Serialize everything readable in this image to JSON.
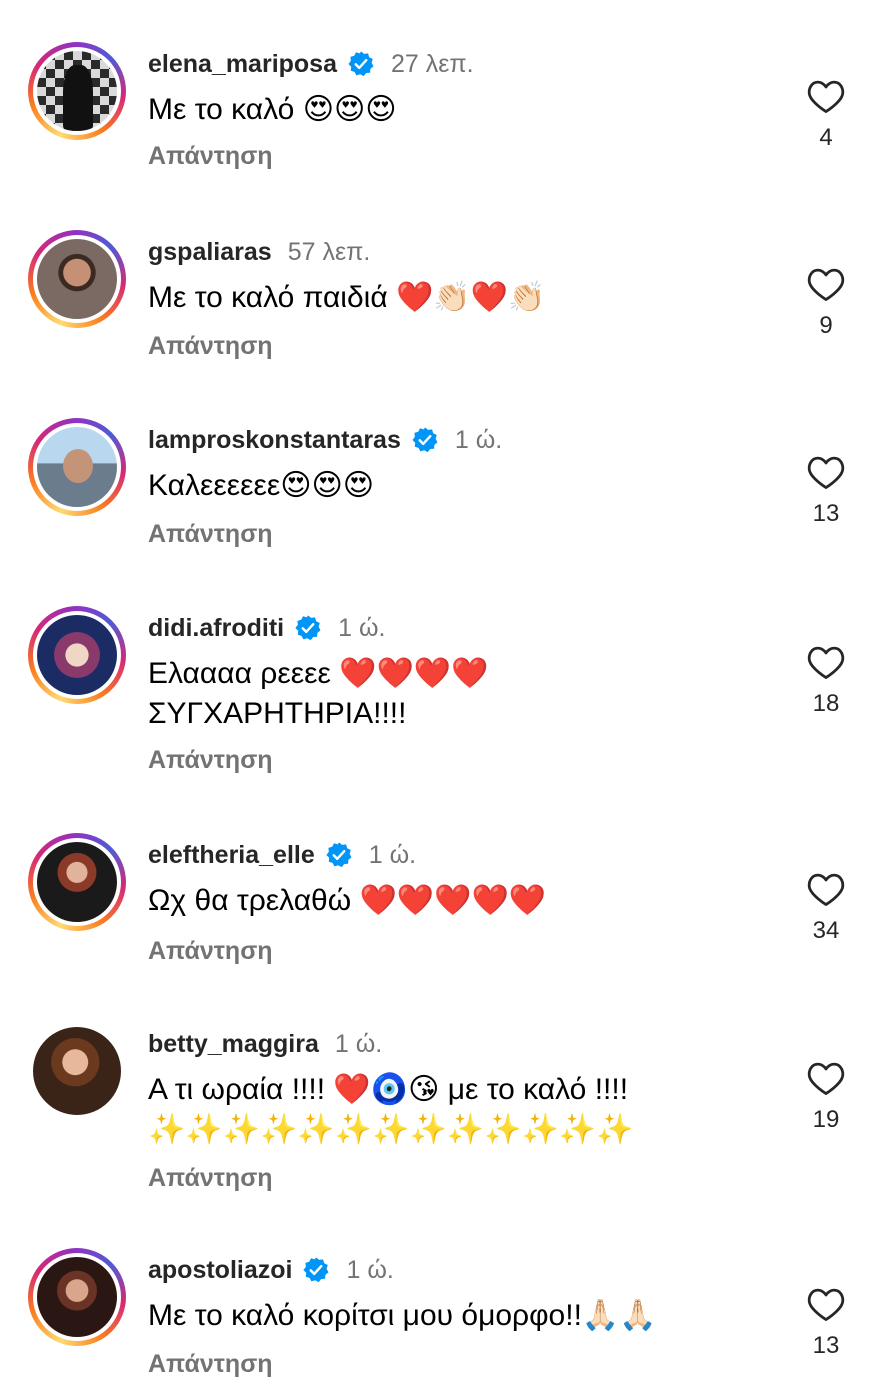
{
  "comments": [
    {
      "username": "elena_mariposa",
      "verified": true,
      "time": "27 λεπ.",
      "text": "Με το καλό 😍😍😍",
      "reply": "Απάντηση",
      "likes": "4",
      "story_ring": true
    },
    {
      "username": "gspaliaras",
      "verified": false,
      "time": "57 λεπ.",
      "text": "Με το καλό παιδιά ❤️👏🏻❤️👏🏻",
      "reply": "Απάντηση",
      "likes": "9",
      "story_ring": true
    },
    {
      "username": "lamproskonstantaras",
      "verified": true,
      "time": "1 ώ.",
      "text": "Καλεεεεεε😍😍😍",
      "reply": "Απάντηση",
      "likes": "13",
      "story_ring": true
    },
    {
      "username": "didi.afroditi",
      "verified": true,
      "time": "1 ώ.",
      "text": "Ελαααα ρεεεε ❤️❤️❤️❤️ ΣΥΓΧΑΡΗΤΗΡΙΑ!!!!",
      "reply": "Απάντηση",
      "likes": "18",
      "story_ring": true
    },
    {
      "username": "eleftheria_elle",
      "verified": true,
      "time": "1 ώ.",
      "text": "Ωχ θα τρελαθώ ❤️❤️❤️❤️❤️",
      "reply": "Απάντηση",
      "likes": "34",
      "story_ring": true
    },
    {
      "username": "betty_maggira",
      "verified": false,
      "time": "1 ώ.",
      "text": "Α τι ωραία !!!! ❤️🧿😘 με το καλό !!!! ✨✨✨✨✨✨✨✨✨✨✨✨✨",
      "reply": "Απάντηση",
      "likes": "19",
      "story_ring": false
    },
    {
      "username": "apostoliazoi",
      "verified": true,
      "time": "1 ώ.",
      "text": "Με το καλό κορίτσι μου όμορφο!!🙏🏻🙏🏻",
      "reply": "Απάντηση",
      "likes": "13",
      "story_ring": true
    }
  ],
  "colors": {
    "verified_badge": "#0095f6",
    "secondary_text": "#737373",
    "primary_text": "#262626"
  },
  "icons": {
    "like": "heart-outline-icon",
    "verified": "verified-badge-icon"
  }
}
